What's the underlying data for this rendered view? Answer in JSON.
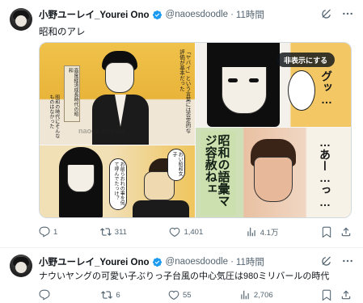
{
  "tweets": [
    {
      "author": "小野ユーレイ_Yourei Ono",
      "handle": "@naoesdoodle",
      "time": "11時間",
      "text": "昭和のアレ",
      "media": {
        "hide_label": "非表示にする",
        "panel_texts": {
          "sign": "高度経済成長時代の昭和",
          "narration": "「ヤバイ」という言葉には否定的な評価が基本だった",
          "speech_showa": "昭和の時代にそんなものはなかった",
          "speech_oi": "おい昭和女子",
          "speech_omae": "お前らおれの事を何て呼んでたっけ？",
          "sfx_gu": "グッ…",
          "sfx_aa": "…あー…っ…",
          "showa_go": "昭和の語彙マジ容赦ねェ",
          "watermark": "naoes doodle"
        }
      },
      "metrics": {
        "replies": "1",
        "retweets": "311",
        "likes": "1,401",
        "views": "4.1万"
      }
    },
    {
      "author": "小野ユーレイ_Yourei Ono",
      "handle": "@naoesdoodle",
      "time": "11時間",
      "text": "ナウいヤングの可愛い子ぶりっ子台風の中心気圧は980ミリバールの時代",
      "metrics": {
        "replies": "",
        "retweets": "6",
        "likes": "55",
        "views": "2,706"
      }
    }
  ],
  "colors": {
    "accent": "#1d9bf0",
    "muted": "#536471",
    "text": "#0f1419"
  },
  "icons": [
    "verified-badge-icon",
    "grok-icon",
    "more-icon",
    "reply-icon",
    "retweet-icon",
    "like-icon",
    "views-icon",
    "bookmark-icon",
    "share-icon"
  ]
}
